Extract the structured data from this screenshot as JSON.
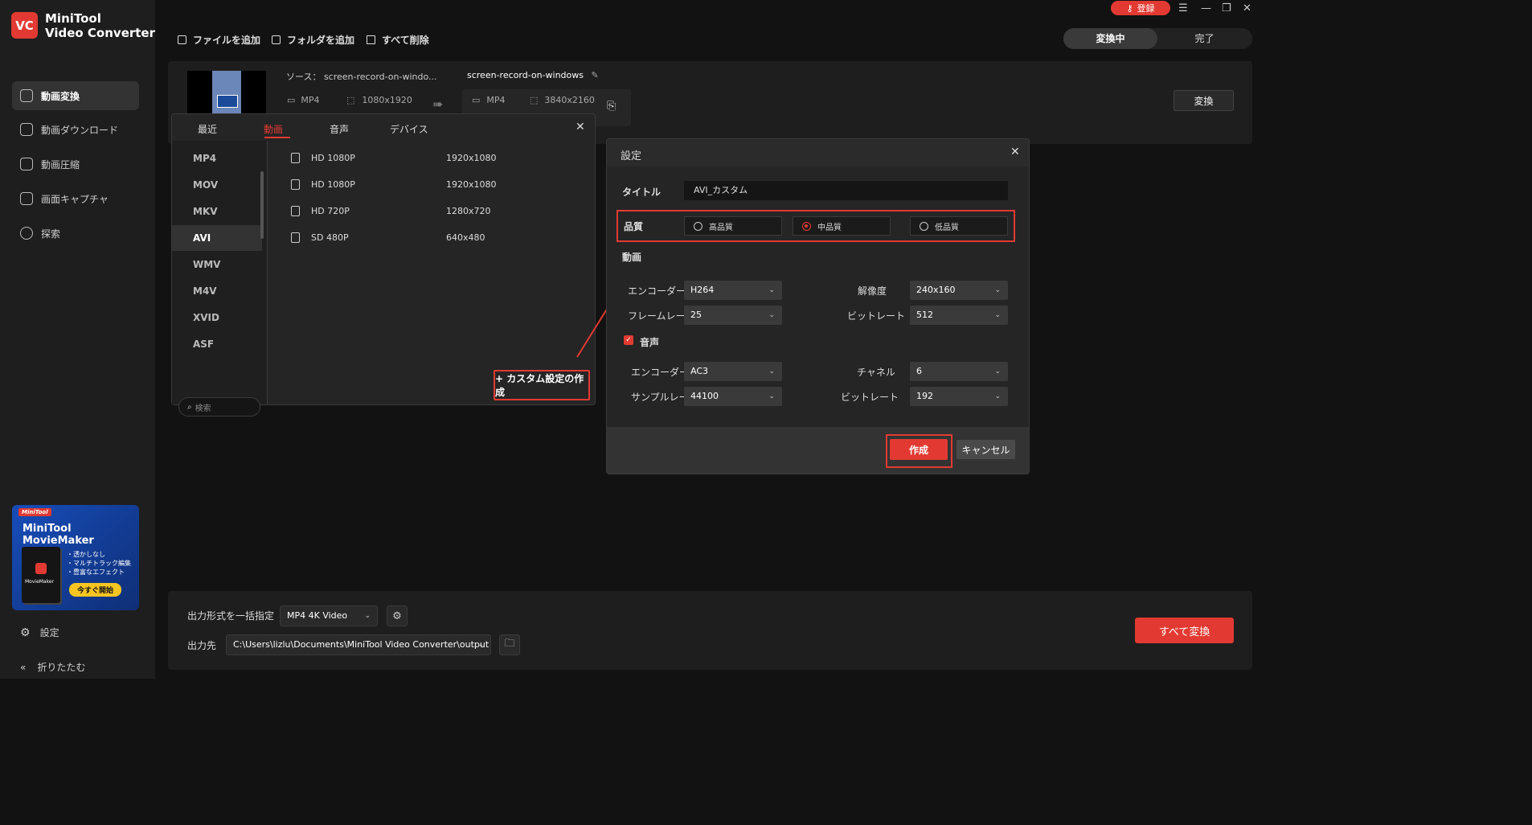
{
  "app": {
    "brand_line1": "MiniTool",
    "brand_line2": "Video Converter",
    "logo_text": "VC"
  },
  "sidebar": {
    "items": [
      {
        "label": "動画変換",
        "icon": "convert-icon"
      },
      {
        "label": "動画ダウンロード",
        "icon": "download-icon"
      },
      {
        "label": "動画圧縮",
        "icon": "compress-icon"
      },
      {
        "label": "画面キャプチャ",
        "icon": "record-icon"
      },
      {
        "label": "探索",
        "icon": "compass-icon"
      }
    ],
    "promo": {
      "brand": "MiniTool",
      "title": "MiniTool MovieMaker",
      "box_label": "MovieMaker",
      "features": [
        "・透かしなし",
        "・マルチトラック編集",
        "・豊富なエフェクト"
      ],
      "button": "今すぐ開始"
    },
    "settings": "設定",
    "collapse": "折りたたむ"
  },
  "topbar": {
    "add_file": "ファイルを追加",
    "add_folder": "フォルダを追加",
    "delete_all": "すべて削除",
    "register": "登録",
    "tab_converting": "変換中",
    "tab_done": "完了"
  },
  "file": {
    "source_label": "ソース：",
    "source_name": "screen-record-on-windo...",
    "source_format": "MP4",
    "source_res": "1080x1920",
    "target_name": "screen-record-on-windows",
    "target_format": "MP4",
    "target_res": "3840x2160",
    "convert": "変換"
  },
  "format_panel": {
    "tabs": [
      "最近",
      "動画",
      "音声",
      "デバイス"
    ],
    "active_tab": "動画",
    "formats": [
      "MP4",
      "MOV",
      "MKV",
      "AVI",
      "WMV",
      "M4V",
      "XVID",
      "ASF"
    ],
    "active_format": "AVI",
    "presets": [
      {
        "name": "HD 1080P",
        "res": "1920x1080"
      },
      {
        "name": "HD 1080P",
        "res": "1920x1080"
      },
      {
        "name": "HD 720P",
        "res": "1280x720"
      },
      {
        "name": "SD 480P",
        "res": "640x480"
      }
    ],
    "search_placeholder": "検索",
    "custom_button": "+ カスタム設定の作成"
  },
  "settings_dialog": {
    "title": "設定",
    "title_label": "タイトル",
    "title_value": "AVI_カスタム",
    "quality_label": "品質",
    "quality_options": [
      "高品質",
      "中品質",
      "低品質"
    ],
    "quality_selected": "中品質",
    "video_section": "動画",
    "encoder_label": "エンコーダー",
    "encoder_value": "H264",
    "resolution_label": "解像度",
    "resolution_value": "240x160",
    "framerate_label": "フレームレート",
    "framerate_value": "25",
    "bitrate_label": "ビットレート",
    "bitrate_value": "512",
    "audio_section": "音声",
    "audio_checked": true,
    "a_encoder_label": "エンコーダー",
    "a_encoder_value": "AC3",
    "channel_label": "チャネル",
    "channel_value": "6",
    "samplerate_label": "サンプルレート",
    "samplerate_value": "44100",
    "a_bitrate_label": "ビットレート",
    "a_bitrate_value": "192",
    "create": "作成",
    "cancel": "キャンセル"
  },
  "bottom": {
    "output_format_label": "出力形式を一括指定",
    "output_format_value": "MP4 4K Video",
    "output_dir_label": "出力先",
    "output_dir_value": "C:\\Users\\lizlu\\Documents\\MiniTool Video Converter\\output",
    "convert_all": "すべて変換"
  },
  "colors": {
    "accent": "#e23a32",
    "bg": "#121212",
    "panel": "#1e1e1e"
  }
}
